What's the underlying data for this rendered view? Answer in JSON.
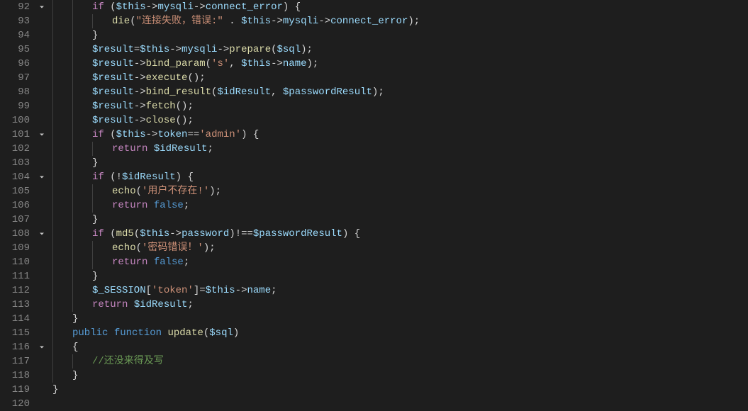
{
  "gutter": {
    "start": 92,
    "end": 120
  },
  "foldable_lines": [
    92,
    101,
    104,
    108,
    116
  ],
  "colors": {
    "background": "#1e1e1e",
    "foreground": "#d4d4d4",
    "gutter": "#858585",
    "keyword": "#569cd6",
    "control": "#c586c0",
    "variable": "#9cdcfe",
    "function": "#dcdcaa",
    "string": "#ce9178",
    "comment": "#6a9955"
  },
  "code": {
    "l92": {
      "indent": 2,
      "guides": [
        1,
        2
      ],
      "tokens": [
        {
          "t": "if ",
          "c": "control"
        },
        {
          "t": "(",
          "c": "punc"
        },
        {
          "t": "$this",
          "c": "var"
        },
        {
          "t": "->",
          "c": "op"
        },
        {
          "t": "mysqli",
          "c": "var"
        },
        {
          "t": "->",
          "c": "op"
        },
        {
          "t": "connect_error",
          "c": "var"
        },
        {
          "t": ") {",
          "c": "punc"
        }
      ]
    },
    "l93": {
      "indent": 3,
      "guides": [
        1,
        2,
        3
      ],
      "tokens": [
        {
          "t": "die",
          "c": "func"
        },
        {
          "t": "(",
          "c": "punc"
        },
        {
          "t": "\"连接失败，错误:\"",
          "c": "string"
        },
        {
          "t": " . ",
          "c": "op"
        },
        {
          "t": "$this",
          "c": "var"
        },
        {
          "t": "->",
          "c": "op"
        },
        {
          "t": "mysqli",
          "c": "var"
        },
        {
          "t": "->",
          "c": "op"
        },
        {
          "t": "connect_error",
          "c": "var"
        },
        {
          "t": ");",
          "c": "punc"
        }
      ]
    },
    "l94": {
      "indent": 2,
      "guides": [
        1,
        2
      ],
      "tokens": [
        {
          "t": "}",
          "c": "punc"
        }
      ]
    },
    "l95": {
      "indent": 2,
      "guides": [
        1,
        2
      ],
      "tokens": [
        {
          "t": "$result",
          "c": "var"
        },
        {
          "t": "=",
          "c": "op"
        },
        {
          "t": "$this",
          "c": "var"
        },
        {
          "t": "->",
          "c": "op"
        },
        {
          "t": "mysqli",
          "c": "var"
        },
        {
          "t": "->",
          "c": "op"
        },
        {
          "t": "prepare",
          "c": "func"
        },
        {
          "t": "(",
          "c": "punc"
        },
        {
          "t": "$sql",
          "c": "var"
        },
        {
          "t": ");",
          "c": "punc"
        }
      ]
    },
    "l96": {
      "indent": 2,
      "guides": [
        1,
        2
      ],
      "tokens": [
        {
          "t": "$result",
          "c": "var"
        },
        {
          "t": "->",
          "c": "op"
        },
        {
          "t": "bind_param",
          "c": "func"
        },
        {
          "t": "(",
          "c": "punc"
        },
        {
          "t": "'s'",
          "c": "string"
        },
        {
          "t": ", ",
          "c": "punc"
        },
        {
          "t": "$this",
          "c": "var"
        },
        {
          "t": "->",
          "c": "op"
        },
        {
          "t": "name",
          "c": "var"
        },
        {
          "t": ");",
          "c": "punc"
        }
      ]
    },
    "l97": {
      "indent": 2,
      "guides": [
        1,
        2
      ],
      "tokens": [
        {
          "t": "$result",
          "c": "var"
        },
        {
          "t": "->",
          "c": "op"
        },
        {
          "t": "execute",
          "c": "func"
        },
        {
          "t": "();",
          "c": "punc"
        }
      ]
    },
    "l98": {
      "indent": 2,
      "guides": [
        1,
        2
      ],
      "tokens": [
        {
          "t": "$result",
          "c": "var"
        },
        {
          "t": "->",
          "c": "op"
        },
        {
          "t": "bind_result",
          "c": "func"
        },
        {
          "t": "(",
          "c": "punc"
        },
        {
          "t": "$idResult",
          "c": "var"
        },
        {
          "t": ", ",
          "c": "punc"
        },
        {
          "t": "$passwordResult",
          "c": "var"
        },
        {
          "t": ");",
          "c": "punc"
        }
      ]
    },
    "l99": {
      "indent": 2,
      "guides": [
        1,
        2
      ],
      "tokens": [
        {
          "t": "$result",
          "c": "var"
        },
        {
          "t": "->",
          "c": "op"
        },
        {
          "t": "fetch",
          "c": "func"
        },
        {
          "t": "();",
          "c": "punc"
        }
      ]
    },
    "l100": {
      "indent": 2,
      "guides": [
        1,
        2
      ],
      "tokens": [
        {
          "t": "$result",
          "c": "var"
        },
        {
          "t": "->",
          "c": "op"
        },
        {
          "t": "close",
          "c": "func"
        },
        {
          "t": "();",
          "c": "punc"
        }
      ]
    },
    "l101": {
      "indent": 2,
      "guides": [
        1,
        2
      ],
      "tokens": [
        {
          "t": "if ",
          "c": "control"
        },
        {
          "t": "(",
          "c": "punc"
        },
        {
          "t": "$this",
          "c": "var"
        },
        {
          "t": "->",
          "c": "op"
        },
        {
          "t": "token",
          "c": "var"
        },
        {
          "t": "==",
          "c": "op"
        },
        {
          "t": "'admin'",
          "c": "string"
        },
        {
          "t": ") {",
          "c": "punc"
        }
      ]
    },
    "l102": {
      "indent": 3,
      "guides": [
        1,
        2,
        3
      ],
      "tokens": [
        {
          "t": "return ",
          "c": "control"
        },
        {
          "t": "$idResult",
          "c": "var"
        },
        {
          "t": ";",
          "c": "punc"
        }
      ]
    },
    "l103": {
      "indent": 2,
      "guides": [
        1,
        2
      ],
      "tokens": [
        {
          "t": "}",
          "c": "punc"
        }
      ]
    },
    "l104": {
      "indent": 2,
      "guides": [
        1,
        2
      ],
      "tokens": [
        {
          "t": "if ",
          "c": "control"
        },
        {
          "t": "(!",
          "c": "op"
        },
        {
          "t": "$idResult",
          "c": "var"
        },
        {
          "t": ") {",
          "c": "punc"
        }
      ]
    },
    "l105": {
      "indent": 3,
      "guides": [
        1,
        2,
        3
      ],
      "tokens": [
        {
          "t": "echo",
          "c": "func"
        },
        {
          "t": "(",
          "c": "punc"
        },
        {
          "t": "'用户不存在!'",
          "c": "string"
        },
        {
          "t": ");",
          "c": "punc"
        }
      ]
    },
    "l106": {
      "indent": 3,
      "guides": [
        1,
        2,
        3
      ],
      "tokens": [
        {
          "t": "return ",
          "c": "control"
        },
        {
          "t": "false",
          "c": "const"
        },
        {
          "t": ";",
          "c": "punc"
        }
      ]
    },
    "l107": {
      "indent": 2,
      "guides": [
        1,
        2
      ],
      "tokens": [
        {
          "t": "}",
          "c": "punc"
        }
      ]
    },
    "l108": {
      "indent": 2,
      "guides": [
        1,
        2
      ],
      "tokens": [
        {
          "t": "if ",
          "c": "control"
        },
        {
          "t": "(",
          "c": "punc"
        },
        {
          "t": "md5",
          "c": "func"
        },
        {
          "t": "(",
          "c": "punc"
        },
        {
          "t": "$this",
          "c": "var"
        },
        {
          "t": "->",
          "c": "op"
        },
        {
          "t": "password",
          "c": "var"
        },
        {
          "t": ")!==",
          "c": "op"
        },
        {
          "t": "$passwordResult",
          "c": "var"
        },
        {
          "t": ") {",
          "c": "punc"
        }
      ]
    },
    "l109": {
      "indent": 3,
      "guides": [
        1,
        2,
        3
      ],
      "tokens": [
        {
          "t": "echo",
          "c": "func"
        },
        {
          "t": "(",
          "c": "punc"
        },
        {
          "t": "'密码错误！'",
          "c": "string"
        },
        {
          "t": ");",
          "c": "punc"
        }
      ]
    },
    "l110": {
      "indent": 3,
      "guides": [
        1,
        2,
        3
      ],
      "tokens": [
        {
          "t": "return ",
          "c": "control"
        },
        {
          "t": "false",
          "c": "const"
        },
        {
          "t": ";",
          "c": "punc"
        }
      ]
    },
    "l111": {
      "indent": 2,
      "guides": [
        1,
        2
      ],
      "tokens": [
        {
          "t": "}",
          "c": "punc"
        }
      ]
    },
    "l112": {
      "indent": 2,
      "guides": [
        1,
        2
      ],
      "tokens": [
        {
          "t": "$_SESSION",
          "c": "var"
        },
        {
          "t": "[",
          "c": "punc"
        },
        {
          "t": "'token'",
          "c": "string"
        },
        {
          "t": "]=",
          "c": "op"
        },
        {
          "t": "$this",
          "c": "var"
        },
        {
          "t": "->",
          "c": "op"
        },
        {
          "t": "name",
          "c": "var"
        },
        {
          "t": ";",
          "c": "punc"
        }
      ]
    },
    "l113": {
      "indent": 2,
      "guides": [
        1,
        2
      ],
      "tokens": [
        {
          "t": "return ",
          "c": "control"
        },
        {
          "t": "$idResult",
          "c": "var"
        },
        {
          "t": ";",
          "c": "punc"
        }
      ]
    },
    "l114": {
      "indent": 1,
      "guides": [
        1
      ],
      "tokens": [
        {
          "t": "}",
          "c": "punc"
        }
      ]
    },
    "l115": {
      "indent": 1,
      "guides": [
        1
      ],
      "tokens": [
        {
          "t": "public ",
          "c": "keyword"
        },
        {
          "t": "function ",
          "c": "keyword"
        },
        {
          "t": "update",
          "c": "func"
        },
        {
          "t": "(",
          "c": "punc"
        },
        {
          "t": "$sql",
          "c": "var"
        },
        {
          "t": ")",
          "c": "punc"
        }
      ]
    },
    "l116": {
      "indent": 1,
      "guides": [
        1
      ],
      "tokens": [
        {
          "t": "{",
          "c": "punc"
        }
      ]
    },
    "l117": {
      "indent": 2,
      "guides": [
        1,
        2
      ],
      "tokens": [
        {
          "t": "//还没来得及写",
          "c": "comment"
        }
      ]
    },
    "l118": {
      "indent": 1,
      "guides": [
        1
      ],
      "tokens": [
        {
          "t": "}",
          "c": "punc"
        }
      ]
    },
    "l119": {
      "indent": 0,
      "guides": [],
      "tokens": [
        {
          "t": "}",
          "c": "punc"
        }
      ]
    },
    "l120": {
      "indent": 0,
      "guides": [],
      "tokens": []
    }
  }
}
